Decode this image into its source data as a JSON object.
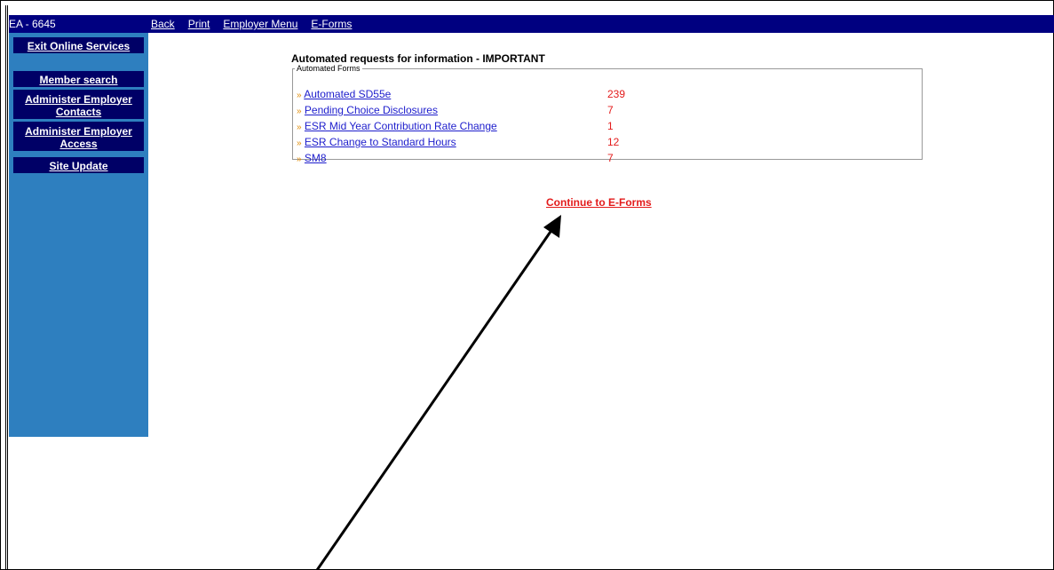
{
  "topbar": {
    "account": "EA - 6645",
    "links": [
      "Back",
      "Print",
      "Employer Menu",
      "E-Forms"
    ]
  },
  "sidebar": {
    "items": [
      {
        "label": "Exit Online Services"
      },
      {
        "label": "Member search"
      },
      {
        "label": "Administer Employer Contacts"
      },
      {
        "label": "Administer Employer Access"
      },
      {
        "label": "Site Update"
      }
    ]
  },
  "main": {
    "title": "Automated requests for information - IMPORTANT",
    "legend": "Automated Forms",
    "bullet": "»",
    "forms": [
      {
        "name": "Automated SD55e",
        "count": "239"
      },
      {
        "name": "Pending Choice Disclosures",
        "count": "7"
      },
      {
        "name": "ESR Mid Year Contribution Rate Change",
        "count": "1"
      },
      {
        "name": "ESR Change to Standard Hours",
        "count": "12"
      },
      {
        "name": "SM8",
        "count": "7"
      }
    ],
    "continue_label": "Continue to E-Forms"
  },
  "colors": {
    "topbar": "#000080",
    "sidebar": "#2e7fbf",
    "sidebar_button": "#000066",
    "link": "#1d1dcc",
    "count": "#e31b1b",
    "bullet": "#e08a00"
  }
}
